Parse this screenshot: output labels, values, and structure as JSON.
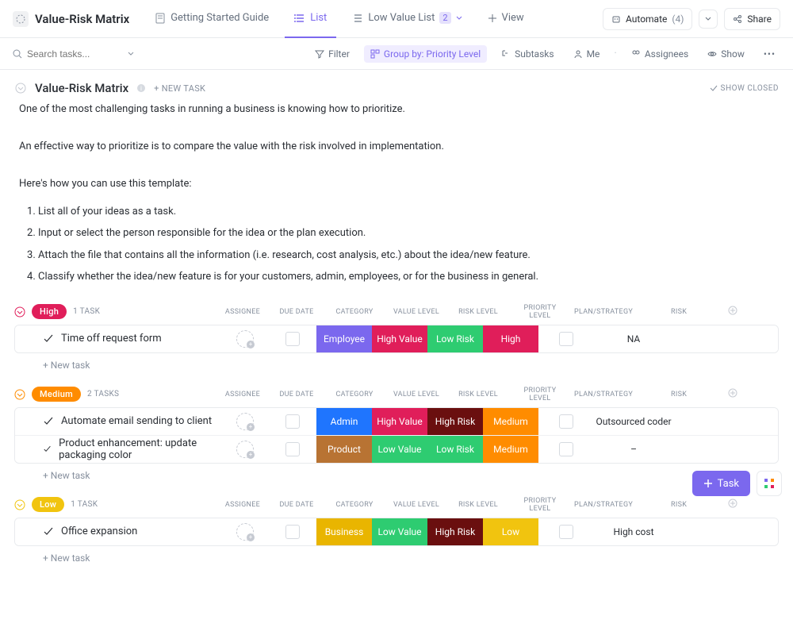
{
  "header": {
    "title": "Value-Risk Matrix",
    "tabs": [
      {
        "label": "Getting Started Guide",
        "icon": "doc"
      },
      {
        "label": "List",
        "icon": "list",
        "active": true
      },
      {
        "label": "Low Value List",
        "icon": "list",
        "badge": "2"
      },
      {
        "label": "View",
        "icon": "plus"
      }
    ],
    "automate_label": "Automate",
    "automate_count": "(4)",
    "share_label": "Share"
  },
  "toolbar": {
    "search_placeholder": "Search tasks...",
    "filter_label": "Filter",
    "group_label": "Group by: Priority Level",
    "subtasks_label": "Subtasks",
    "me_label": "Me",
    "assignees_label": "Assignees",
    "show_label": "Show"
  },
  "list": {
    "title": "Value-Risk Matrix",
    "new_task_label": "+ NEW TASK",
    "show_closed_label": "SHOW CLOSED",
    "desc_p1": "One of the most challenging tasks in running a business is knowing how to prioritize.",
    "desc_p2": "An effective way to prioritize is to compare the value with the risk involved in implementation.",
    "desc_p3": "Here's how you can use this template:",
    "steps": [
      "List all of your ideas as a task.",
      "Input or select the person responsible for the idea or the plan execution.",
      "Attach the file that contains all the information (i.e. research, cost analysis, etc.) about the idea/new feature.",
      "Classify whether the idea/new feature is for your customers, admin, employees, or for the business in general."
    ]
  },
  "columns": {
    "assignee": "ASSIGNEE",
    "due_date": "DUE DATE",
    "category": "CATEGORY",
    "value_level": "VALUE LEVEL",
    "risk_level": "RISK LEVEL",
    "priority_level": "PRIORITY LEVEL",
    "plan_strategy": "PLAN/STRATEGY",
    "risk": "RISK"
  },
  "groups": [
    {
      "name": "High",
      "color": "#e01e5a",
      "collapse_color": "#e01e5a",
      "count": "1 TASK",
      "tasks": [
        {
          "name": "Time off request form",
          "category": {
            "label": "Employee",
            "cls": "c-employee"
          },
          "value": {
            "label": "High Value",
            "cls": "c-highvalue"
          },
          "risklvl": {
            "label": "Low Risk",
            "cls": "c-lowrisk"
          },
          "prio": {
            "label": "High",
            "cls": "c-high"
          },
          "risk": "NA"
        }
      ]
    },
    {
      "name": "Medium",
      "color": "#ff8c00",
      "collapse_color": "#ff8c00",
      "count": "2 TASKS",
      "tasks": [
        {
          "name": "Automate email sending to client",
          "category": {
            "label": "Admin",
            "cls": "c-admin"
          },
          "value": {
            "label": "High Value",
            "cls": "c-highvalue"
          },
          "risklvl": {
            "label": "High Risk",
            "cls": "c-highrisk"
          },
          "prio": {
            "label": "Medium",
            "cls": "c-medium"
          },
          "risk": "Outsourced coder"
        },
        {
          "name": "Product enhancement: update packaging color",
          "category": {
            "label": "Product",
            "cls": "c-product"
          },
          "value": {
            "label": "Low Value",
            "cls": "c-lowvalue"
          },
          "risklvl": {
            "label": "Low Risk",
            "cls": "c-lowrisk"
          },
          "prio": {
            "label": "Medium",
            "cls": "c-medium"
          },
          "risk": "–"
        }
      ]
    },
    {
      "name": "Low",
      "color": "#f1c40f",
      "collapse_color": "#f1c40f",
      "count": "1 TASK",
      "tasks": [
        {
          "name": "Office expansion",
          "category": {
            "label": "Business",
            "cls": "c-business"
          },
          "value": {
            "label": "Low Value",
            "cls": "c-lowvalue"
          },
          "risklvl": {
            "label": "High Risk",
            "cls": "c-highrisk"
          },
          "prio": {
            "label": "Low",
            "cls": "c-low"
          },
          "risk": "High cost"
        }
      ]
    }
  ],
  "add_task_label": "+ New task",
  "fab_task_label": "Task"
}
